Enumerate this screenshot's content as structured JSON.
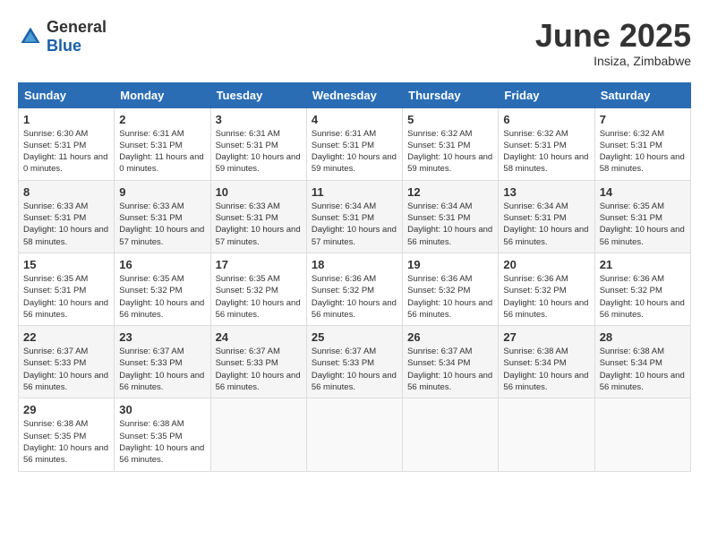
{
  "logo": {
    "general": "General",
    "blue": "Blue"
  },
  "title": "June 2025",
  "subtitle": "Insiza, Zimbabwe",
  "days_of_week": [
    "Sunday",
    "Monday",
    "Tuesday",
    "Wednesday",
    "Thursday",
    "Friday",
    "Saturday"
  ],
  "weeks": [
    [
      {
        "day": "1",
        "sunrise": "6:30 AM",
        "sunset": "5:31 PM",
        "daylight": "11 hours and 0 minutes."
      },
      {
        "day": "2",
        "sunrise": "6:31 AM",
        "sunset": "5:31 PM",
        "daylight": "11 hours and 0 minutes."
      },
      {
        "day": "3",
        "sunrise": "6:31 AM",
        "sunset": "5:31 PM",
        "daylight": "10 hours and 59 minutes."
      },
      {
        "day": "4",
        "sunrise": "6:31 AM",
        "sunset": "5:31 PM",
        "daylight": "10 hours and 59 minutes."
      },
      {
        "day": "5",
        "sunrise": "6:32 AM",
        "sunset": "5:31 PM",
        "daylight": "10 hours and 59 minutes."
      },
      {
        "day": "6",
        "sunrise": "6:32 AM",
        "sunset": "5:31 PM",
        "daylight": "10 hours and 58 minutes."
      },
      {
        "day": "7",
        "sunrise": "6:32 AM",
        "sunset": "5:31 PM",
        "daylight": "10 hours and 58 minutes."
      }
    ],
    [
      {
        "day": "8",
        "sunrise": "6:33 AM",
        "sunset": "5:31 PM",
        "daylight": "10 hours and 58 minutes."
      },
      {
        "day": "9",
        "sunrise": "6:33 AM",
        "sunset": "5:31 PM",
        "daylight": "10 hours and 57 minutes."
      },
      {
        "day": "10",
        "sunrise": "6:33 AM",
        "sunset": "5:31 PM",
        "daylight": "10 hours and 57 minutes."
      },
      {
        "day": "11",
        "sunrise": "6:34 AM",
        "sunset": "5:31 PM",
        "daylight": "10 hours and 57 minutes."
      },
      {
        "day": "12",
        "sunrise": "6:34 AM",
        "sunset": "5:31 PM",
        "daylight": "10 hours and 56 minutes."
      },
      {
        "day": "13",
        "sunrise": "6:34 AM",
        "sunset": "5:31 PM",
        "daylight": "10 hours and 56 minutes."
      },
      {
        "day": "14",
        "sunrise": "6:35 AM",
        "sunset": "5:31 PM",
        "daylight": "10 hours and 56 minutes."
      }
    ],
    [
      {
        "day": "15",
        "sunrise": "6:35 AM",
        "sunset": "5:31 PM",
        "daylight": "10 hours and 56 minutes."
      },
      {
        "day": "16",
        "sunrise": "6:35 AM",
        "sunset": "5:32 PM",
        "daylight": "10 hours and 56 minutes."
      },
      {
        "day": "17",
        "sunrise": "6:35 AM",
        "sunset": "5:32 PM",
        "daylight": "10 hours and 56 minutes."
      },
      {
        "day": "18",
        "sunrise": "6:36 AM",
        "sunset": "5:32 PM",
        "daylight": "10 hours and 56 minutes."
      },
      {
        "day": "19",
        "sunrise": "6:36 AM",
        "sunset": "5:32 PM",
        "daylight": "10 hours and 56 minutes."
      },
      {
        "day": "20",
        "sunrise": "6:36 AM",
        "sunset": "5:32 PM",
        "daylight": "10 hours and 56 minutes."
      },
      {
        "day": "21",
        "sunrise": "6:36 AM",
        "sunset": "5:32 PM",
        "daylight": "10 hours and 56 minutes."
      }
    ],
    [
      {
        "day": "22",
        "sunrise": "6:37 AM",
        "sunset": "5:33 PM",
        "daylight": "10 hours and 56 minutes."
      },
      {
        "day": "23",
        "sunrise": "6:37 AM",
        "sunset": "5:33 PM",
        "daylight": "10 hours and 56 minutes."
      },
      {
        "day": "24",
        "sunrise": "6:37 AM",
        "sunset": "5:33 PM",
        "daylight": "10 hours and 56 minutes."
      },
      {
        "day": "25",
        "sunrise": "6:37 AM",
        "sunset": "5:33 PM",
        "daylight": "10 hours and 56 minutes."
      },
      {
        "day": "26",
        "sunrise": "6:37 AM",
        "sunset": "5:34 PM",
        "daylight": "10 hours and 56 minutes."
      },
      {
        "day": "27",
        "sunrise": "6:38 AM",
        "sunset": "5:34 PM",
        "daylight": "10 hours and 56 minutes."
      },
      {
        "day": "28",
        "sunrise": "6:38 AM",
        "sunset": "5:34 PM",
        "daylight": "10 hours and 56 minutes."
      }
    ],
    [
      {
        "day": "29",
        "sunrise": "6:38 AM",
        "sunset": "5:35 PM",
        "daylight": "10 hours and 56 minutes."
      },
      {
        "day": "30",
        "sunrise": "6:38 AM",
        "sunset": "5:35 PM",
        "daylight": "10 hours and 56 minutes."
      },
      null,
      null,
      null,
      null,
      null
    ]
  ]
}
